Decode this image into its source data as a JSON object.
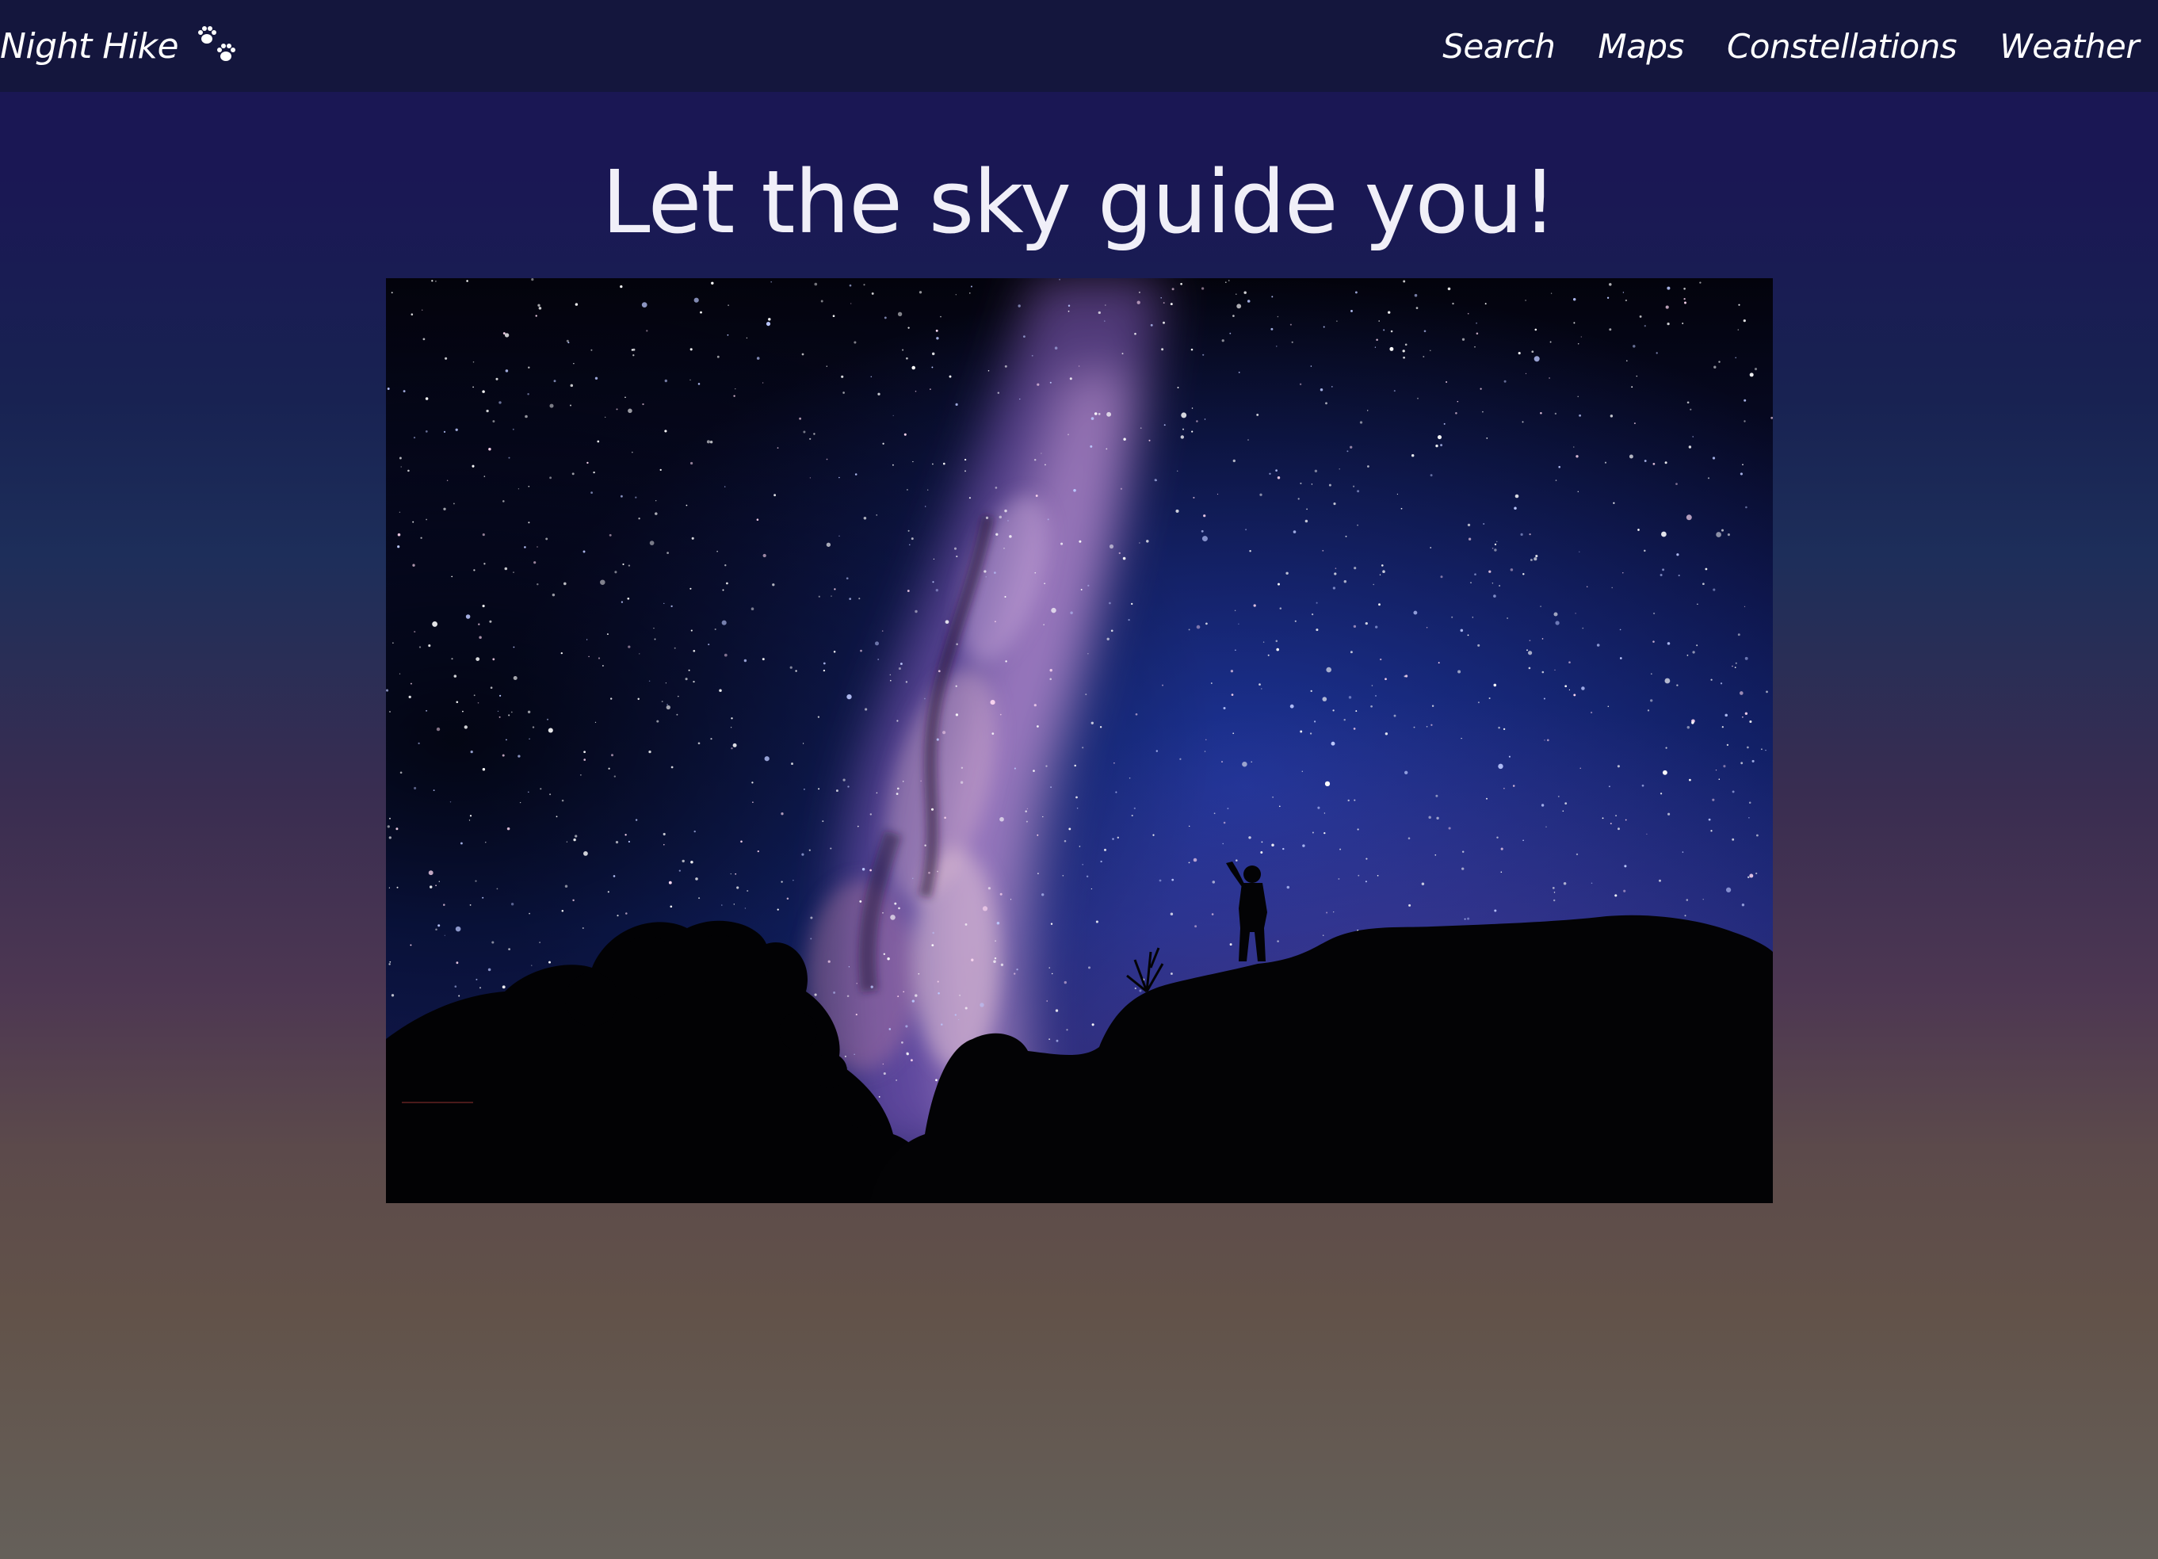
{
  "navbar": {
    "brand": {
      "label": "Night Hike",
      "icon": "paw-prints-icon"
    },
    "links": [
      {
        "label": "Search"
      },
      {
        "label": "Maps"
      },
      {
        "label": "Constellations"
      },
      {
        "label": "Weather"
      }
    ]
  },
  "main": {
    "title": "Let the sky guide you!",
    "hero_image": {
      "subject": "milky-way-night-sky-with-hiker-silhouette"
    }
  },
  "colors": {
    "navbar_bg": "#14163d",
    "page_gradient_top": "#1a1754",
    "page_gradient_bottom": "#65605a",
    "text": "#ffffff"
  }
}
